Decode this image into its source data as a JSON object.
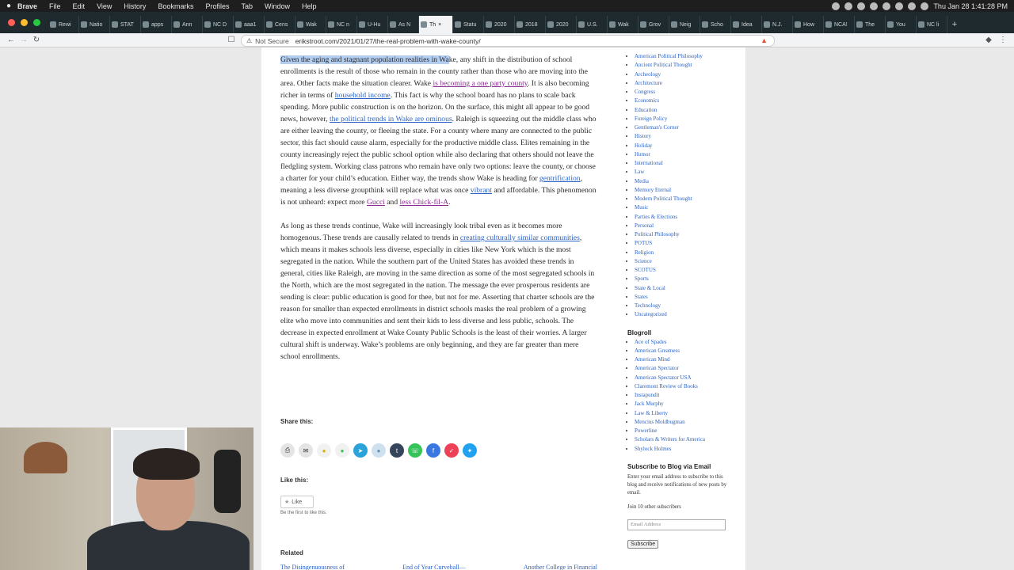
{
  "menubar": {
    "app": "Brave",
    "items": [
      "File",
      "Edit",
      "View",
      "History",
      "Bookmarks",
      "Profiles",
      "Tab",
      "Window",
      "Help"
    ],
    "clock": "Thu Jan 28  1:41:28 PM"
  },
  "tabs": [
    "Rewi",
    "Natio",
    "STAT",
    "apps",
    "Ann",
    "NC D",
    "aaa1",
    "Cens",
    "Wak",
    "NC n",
    "U-Hu",
    "As N",
    "Th",
    "Statu",
    "2020",
    "2018",
    "2020",
    "U.S.",
    "Wak",
    "Grov",
    "Neig",
    "Scho",
    "Idea",
    "N.J.",
    "How",
    "NCA!",
    "The",
    "You",
    "NC li"
  ],
  "address": {
    "security": "Not Secure",
    "url": "erikstroot.com/2021/01/27/the-real-problem-with-wake-county/"
  },
  "article": {
    "p1": {
      "highlight": "Given the aging and stagnant population realities in Wa",
      "t1": "ke, any shift in the distribution of school enrollments is the result of those who remain in the county rather than those who are moving into the area.  Other facts make the situation clearer.  Wake ",
      "l1": "is becoming a one party county",
      "t2": ".  It is also becoming richer in terms of ",
      "l2": "household income",
      "t3": ".  This fact is why the school board has no plans to scale back spending.  More public construction is on the horizon.  On the surface, this might all appear to be good news, however, ",
      "l3": "the political trends in Wake are ominous",
      "t4": ".  Raleigh is squeezing out the middle class who are either leaving the county, or fleeing the state.  For a county where many are connected to the public sector, this fact should cause alarm, especially for the productive middle class.  Elites remaining in the county increasingly reject the public school option while also declaring that others should not leave the fledgling system. Working class patrons who remain have only two options:  leave the county, or choose a charter for your child’s education.  Either way, the trends show Wake is heading for ",
      "l4": "gentrification",
      "t5": ", meaning a less diverse groupthink will replace what was once ",
      "l5": "vibrant",
      "t6": " and affordable.  This phenomenon is not unheard:  expect more ",
      "l6": "Gucci",
      "t7": " and ",
      "l7": "less Chick-fil-A",
      "t8": "."
    },
    "p2": {
      "t1": "As long as these trends continue, Wake will increasingly look tribal even as it becomes more homogenous.  These trends are causally related to trends in ",
      "l1": "creating culturally similar communities",
      "t2": ", which means it makes schools less diverse, especially in cities like New York which is the most segregated in the nation.  While the southern part of the United States has avoided these trends in general, cities like Raleigh, are moving in the same direction as some of the most segregated schools in the North, which are the most segregated in the nation.  The message the ever prosperous residents are sending is clear:  public education is good for thee, but not for me.  Asserting that charter schools are the reason for smaller than expected enrollments in district schools masks the real problem of a growing elite who move into communities and sent their kids to less diverse and less public, schools.  The decrease in expected enrollment at Wake County Public Schools is the least of their worries.  A larger cultural shift is underway.  Wake’s problems are only beginning, and they are far greater than mere school enrollments."
    }
  },
  "share": {
    "heading": "Share this:",
    "buttons": [
      {
        "icon": "print-icon",
        "color": "#e4e4e4"
      },
      {
        "icon": "email-icon",
        "color": "#e4e4e4"
      },
      {
        "icon": "bulb-icon",
        "color": "#f1f1f1"
      },
      {
        "icon": "chat-icon",
        "color": "#f1f1f1"
      },
      {
        "icon": "telegram-icon",
        "color": "#2aa3db"
      },
      {
        "icon": "reddit-icon",
        "color": "#cfe0ef"
      },
      {
        "icon": "tumblr-icon",
        "color": "#35465c"
      },
      {
        "icon": "whatsapp-icon",
        "color": "#35c35a"
      },
      {
        "icon": "facebook-icon",
        "color": "#3b77e0"
      },
      {
        "icon": "pocket-icon",
        "color": "#ee4056"
      },
      {
        "icon": "twitter-icon",
        "color": "#21a2f0"
      }
    ]
  },
  "like": {
    "heading": "Like this:",
    "button": "Like",
    "first": "Be the first to like this."
  },
  "related": {
    "heading": "Related",
    "items": [
      "The Disingenuousness of",
      "End of Year Curveball—",
      "Another College in Financial"
    ]
  },
  "sidebar": {
    "categories": [
      "American Political Philosophy",
      "Ancient Political Thought",
      "Archeology",
      "Architecture",
      "Congress",
      "Economics",
      "Education",
      "Foreign Policy",
      "Gentleman's Corner",
      "History",
      "Holiday",
      "Humor",
      "International",
      "Law",
      "Media",
      "Memory Eternal",
      "Modern Political Thought",
      "Music",
      "Parties & Elections",
      "Personal",
      "Political Philosophy",
      "POTUS",
      "Religion",
      "Science",
      "SCOTUS",
      "Sports",
      "State & Local",
      "States",
      "Technology",
      "Uncategorized"
    ],
    "blogroll_heading": "Blogroll",
    "blogroll": [
      "Ace of Spades",
      "American Greatness",
      "American Mind",
      "American Spectator",
      "American Spectator USA",
      "Claremont Review of Books",
      "Instapundit",
      "Jack Murphy",
      "Law & Liberty",
      "Mencius Moldbugman",
      "Powerline",
      "Scholars & Writers for America",
      "Shylock Holmes"
    ],
    "subscribe_heading": "Subscribe to Blog via Email",
    "subscribe_text": "Enter your email address to subscribe to this blog and receive notifications of new posts by email.",
    "join": "Join 10 other subscribers",
    "email_placeholder": "Email Address",
    "subscribe_button": "Subscribe"
  }
}
